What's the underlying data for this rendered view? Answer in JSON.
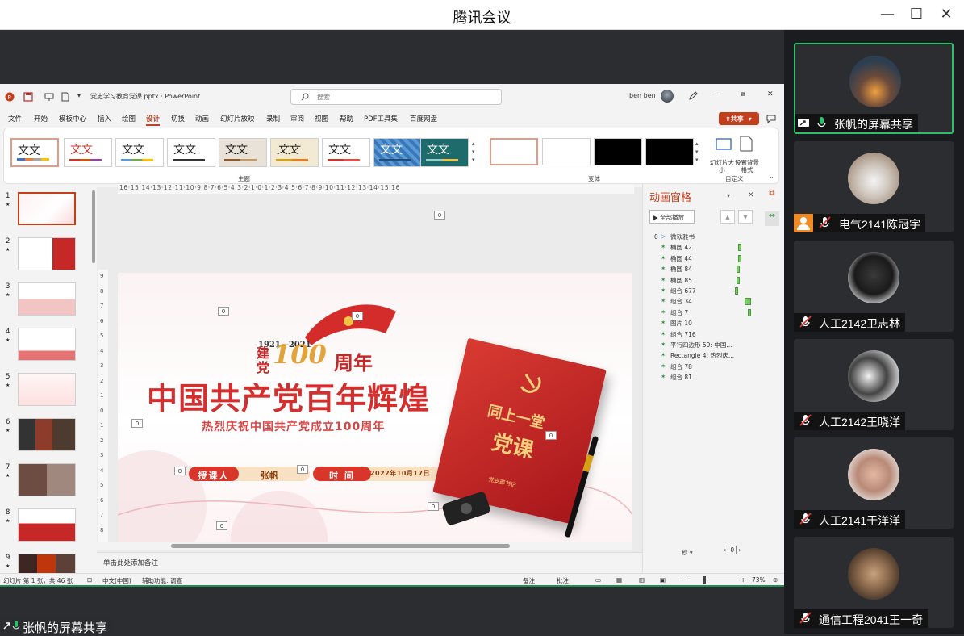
{
  "app": {
    "title": "腾讯会议",
    "min": "—",
    "max": "☐",
    "close": "✕"
  },
  "ppt": {
    "filename": "党史学习教育党课.pptx  ·  PowerPoint",
    "search_placeholder": "搜索",
    "user": "ben ben",
    "share_label": "共享",
    "menu": [
      "文件",
      "开始",
      "模板中心",
      "插入",
      "绘图",
      "设计",
      "切换",
      "动画",
      "幻灯片放映",
      "录制",
      "审阅",
      "视图",
      "帮助",
      "PDF工具集",
      "百度网盘"
    ],
    "active_menu": "设计",
    "theme_sample": "文文",
    "themes_label": "主题",
    "variants_label": "变体",
    "customize_label": "自定义",
    "slide_size": "幻灯片大小",
    "bg_format": "设置背景格式",
    "notes_placeholder": "单击此处添加备注",
    "status": {
      "slide_info": "幻灯片 第 1 张，共 46 张",
      "language": "中文(中国)",
      "accessibility": "辅助功能: 调查",
      "notes": "备注",
      "comments": "批注",
      "zoom": "73%"
    },
    "ruler_h": "16·15·14·13·12·11·10·9·8·7·6·5·4·3·2·1·0·1·2·3·4·5·6·7·8·9·10·11·12·13·14·15·16",
    "thumb_numbers": [
      "1",
      "2",
      "3",
      "4",
      "5",
      "6",
      "7",
      "8",
      "9"
    ]
  },
  "slide": {
    "years": "1921—2021",
    "party_label_1": "建",
    "party_label_2": "党",
    "hundred": "100",
    "zhou_nian": "周年",
    "main_title": "中国共产党百年辉煌",
    "subtitle": "热烈庆祝中国共产党成立100周年",
    "lecturer_label": "授课人",
    "lecturer": "张帆",
    "time_label": "时  间",
    "date": "2022年10月17日",
    "book_line1": "同上一堂",
    "book_line2": "党课",
    "book_footer": "党支部书记",
    "placeholder_zero": "0"
  },
  "anim_pane": {
    "title": "动画窗格",
    "play_all": "全部播放",
    "items": [
      {
        "label": "微软雅书"
      },
      {
        "label": "椭圆 42"
      },
      {
        "label": "椭圆 44"
      },
      {
        "label": "椭圆 84"
      },
      {
        "label": "椭圆 85"
      },
      {
        "label": "组合 677"
      },
      {
        "label": "组合 34"
      },
      {
        "label": "组合 7"
      },
      {
        "label": "图片 10"
      },
      {
        "label": "组合 716"
      },
      {
        "label": "平行四边形 59: 中国..."
      },
      {
        "label": "Rectangle 4: 热烈庆..."
      },
      {
        "label": "组合 78"
      },
      {
        "label": "组合 81"
      }
    ],
    "first_index": "0",
    "seconds_label": "秒",
    "seconds_value": "0"
  },
  "sharer_tag": "张帆的屏幕共享",
  "participants": [
    {
      "name": "张帆的屏幕共享",
      "active": true,
      "mic": "on"
    },
    {
      "name": "电气2141陈冠宇",
      "active": false,
      "mic": "muted"
    },
    {
      "name": "人工2142卫志林",
      "active": false,
      "mic": "muted"
    },
    {
      "name": "人工2142王晓洋",
      "active": false,
      "mic": "muted"
    },
    {
      "name": "人工2141于洋洋",
      "active": false,
      "mic": "muted"
    },
    {
      "name": "通信工程2041王一奇",
      "active": false,
      "mic": "muted"
    }
  ],
  "colors": {
    "accent_red": "#c43e1c",
    "party_red": "#d32f2f",
    "active_green": "#2fbf6b"
  }
}
